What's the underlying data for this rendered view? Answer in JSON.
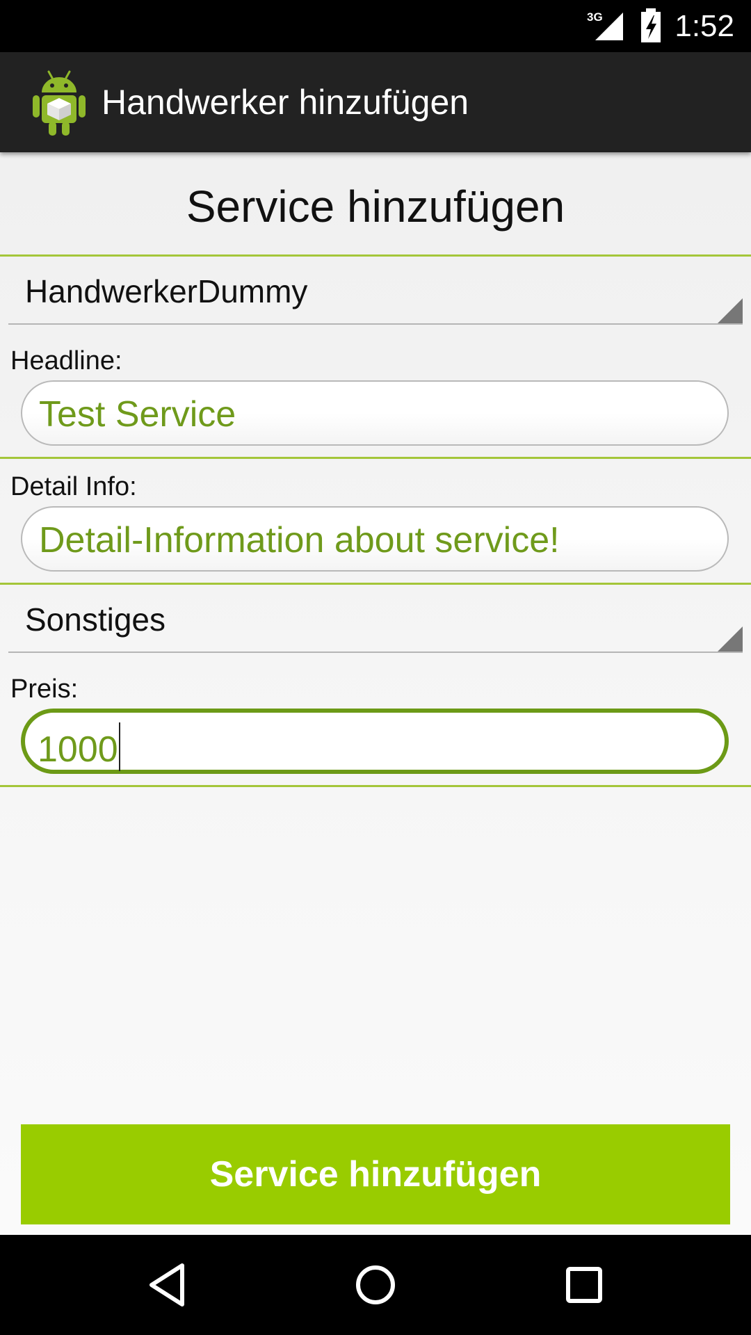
{
  "status_bar": {
    "time": "1:52",
    "network_label": "3G",
    "signal_icon": "cell-signal-icon",
    "battery_icon": "battery-charging-icon"
  },
  "action_bar": {
    "title": "Handwerker hinzufügen",
    "app_icon": "android-robot-icon"
  },
  "form": {
    "page_title": "Service hinzufügen",
    "craftsman_spinner": {
      "selected": "HandwerkerDummy"
    },
    "headline": {
      "label": "Headline:",
      "value": "Test Service"
    },
    "detail": {
      "label": "Detail Info:",
      "value": "Detail-Information about service!"
    },
    "category_spinner": {
      "selected": "Sonstiges"
    },
    "price": {
      "label": "Preis:",
      "value": "1000"
    },
    "submit_label": "Service hinzufügen"
  },
  "nav_bar": {
    "back_icon": "back-triangle-icon",
    "home_icon": "home-circle-icon",
    "recents_icon": "recents-square-icon"
  },
  "colors": {
    "accent_green": "#99cc00",
    "text_green": "#6f9a1b",
    "focus_border": "#6c9a16",
    "divider": "#a4c639",
    "action_bar_bg": "#222222"
  }
}
